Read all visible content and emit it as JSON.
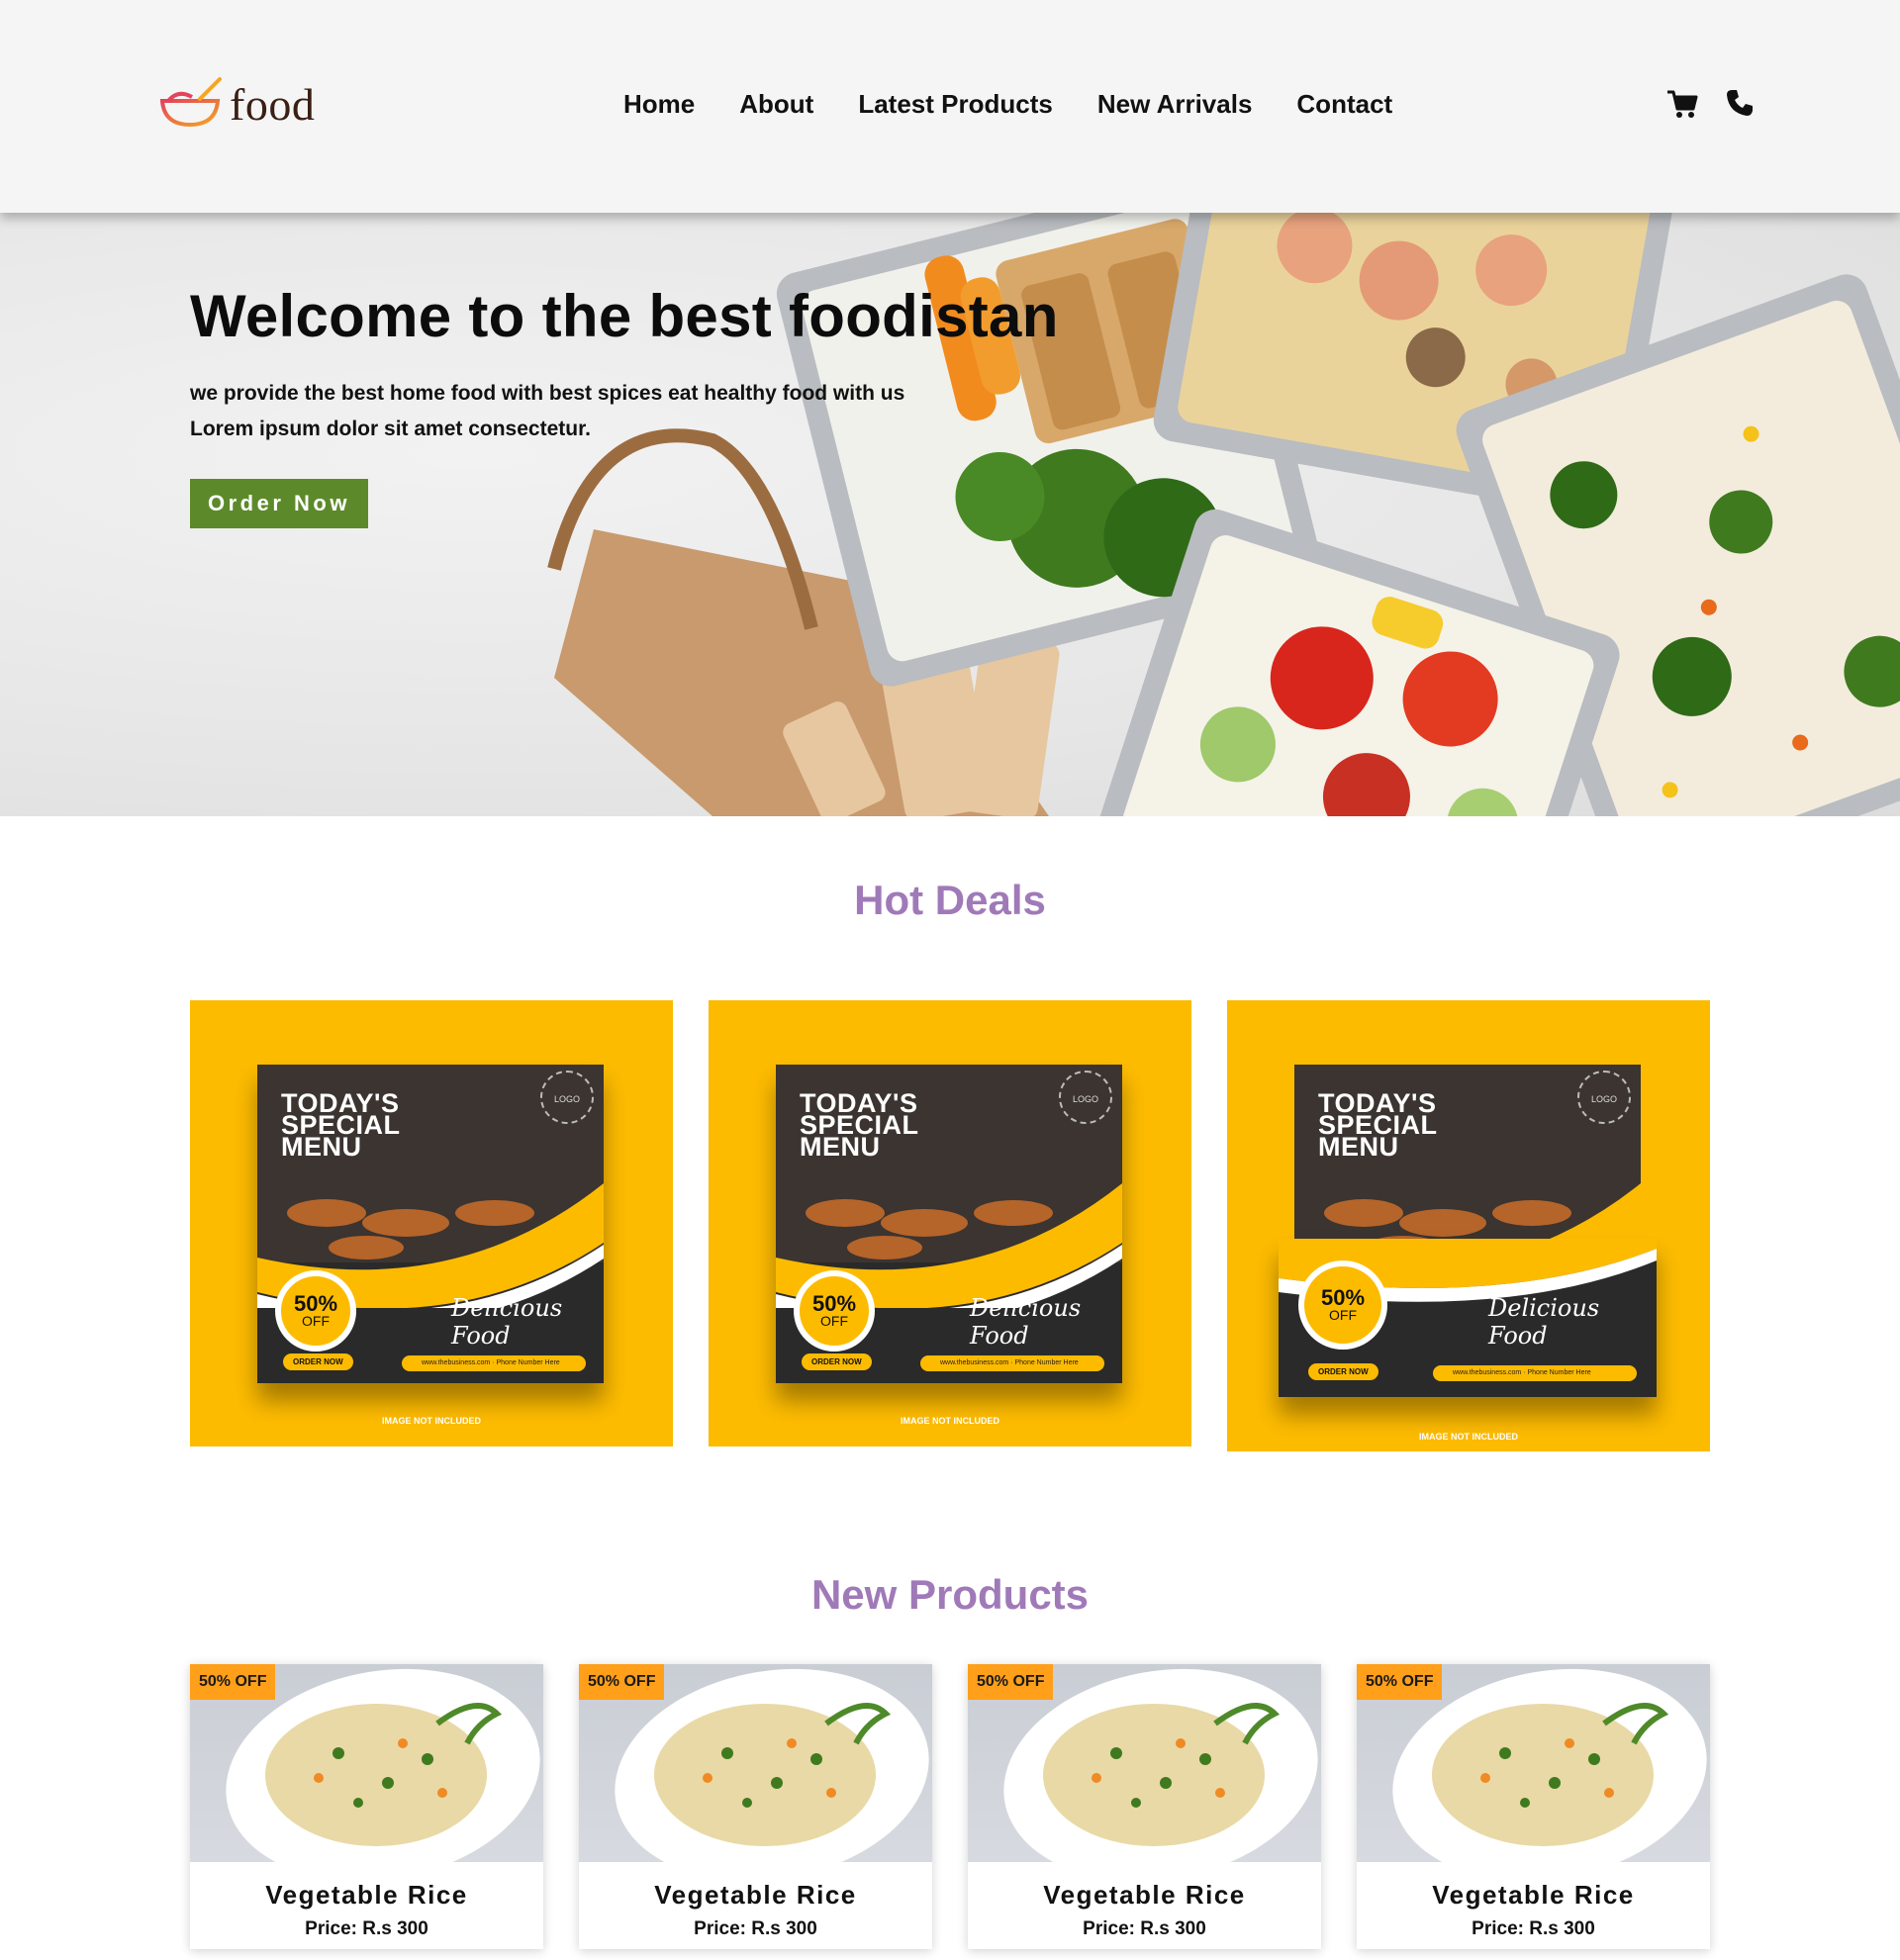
{
  "brand": {
    "name": "food"
  },
  "nav": {
    "items": [
      "Home",
      "About",
      "Latest Products",
      "New Arrivals",
      "Contact"
    ]
  },
  "header_icons": [
    "cart-icon",
    "phone-icon"
  ],
  "hero": {
    "title": "Welcome to the best foodistan",
    "subtitle_line1": "we provide the best home food with best spices eat healthy food with us",
    "subtitle_line2": "Lorem ipsum dolor sit amet consectetur.",
    "cta": "Order Now"
  },
  "hot_deals": {
    "title": "Hot Deals",
    "cards": [
      {
        "headline": "TODAY'S SPECIAL MENU",
        "discount": "50%",
        "discount_suffix": "OFF",
        "script": "Delicious Food",
        "order": "ORDER NOW",
        "website": "www.thebusiness.com",
        "phone": "Phone Number Here",
        "logo": "LOGO",
        "footnote": "IMAGE NOT INCLUDED"
      },
      {
        "headline": "TODAY'S SPECIAL MENU",
        "discount": "50%",
        "discount_suffix": "OFF",
        "script": "Delicious Food",
        "order": "ORDER NOW",
        "website": "www.thebusiness.com",
        "phone": "Phone Number Here",
        "logo": "LOGO",
        "footnote": "IMAGE NOT INCLUDED"
      },
      {
        "headline": "TODAY'S SPECIAL MENU",
        "discount": "50%",
        "discount_suffix": "OFF",
        "script": "Delicious Food",
        "order": "ORDER NOW",
        "website": "www.thebusiness.com",
        "phone": "Phone Number Here",
        "logo": "LOGO",
        "footnote": "IMAGE NOT INCLUDED"
      }
    ]
  },
  "new_products": {
    "title": "New Products",
    "items": [
      {
        "badge": "50% OFF",
        "name": "Vegetable Rice",
        "price": "Price: R.s 300"
      },
      {
        "badge": "50% OFF",
        "name": "Vegetable Rice",
        "price": "Price: R.s 300"
      },
      {
        "badge": "50% OFF",
        "name": "Vegetable Rice",
        "price": "Price: R.s 300"
      },
      {
        "badge": "50% OFF",
        "name": "Vegetable Rice",
        "price": "Price: R.s 300"
      }
    ]
  },
  "colors": {
    "accent": "#a07ab8",
    "cta": "#5c8a2a",
    "deal_bg": "#fdbb00",
    "badge": "#ff9f1a"
  }
}
